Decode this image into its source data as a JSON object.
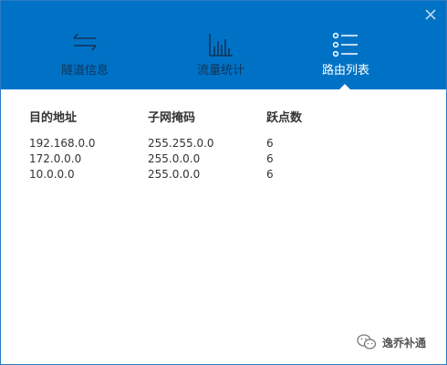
{
  "header": {
    "tabs": [
      {
        "label": "隧道信息",
        "icon": "swap-arrows-icon",
        "active": false
      },
      {
        "label": "流量统计",
        "icon": "bar-chart-icon",
        "active": false
      },
      {
        "label": "路由列表",
        "icon": "list-icon",
        "active": true
      }
    ],
    "close_icon": "close-icon"
  },
  "routes": {
    "columns": [
      "目的地址",
      "子网掩码",
      "跃点数"
    ],
    "rows": [
      [
        "192.168.0.0",
        "255.255.0.0",
        "6"
      ],
      [
        "172.0.0.0",
        "255.0.0.0",
        "6"
      ],
      [
        "10.0.0.0",
        "255.0.0.0",
        "6"
      ]
    ]
  },
  "watermark": {
    "text": "逸乔补通",
    "icon": "wechat-icon"
  },
  "colors": {
    "header_bg": "#0072c6",
    "inactive_tab": "#0f3558",
    "active_tab": "#ffffff"
  }
}
